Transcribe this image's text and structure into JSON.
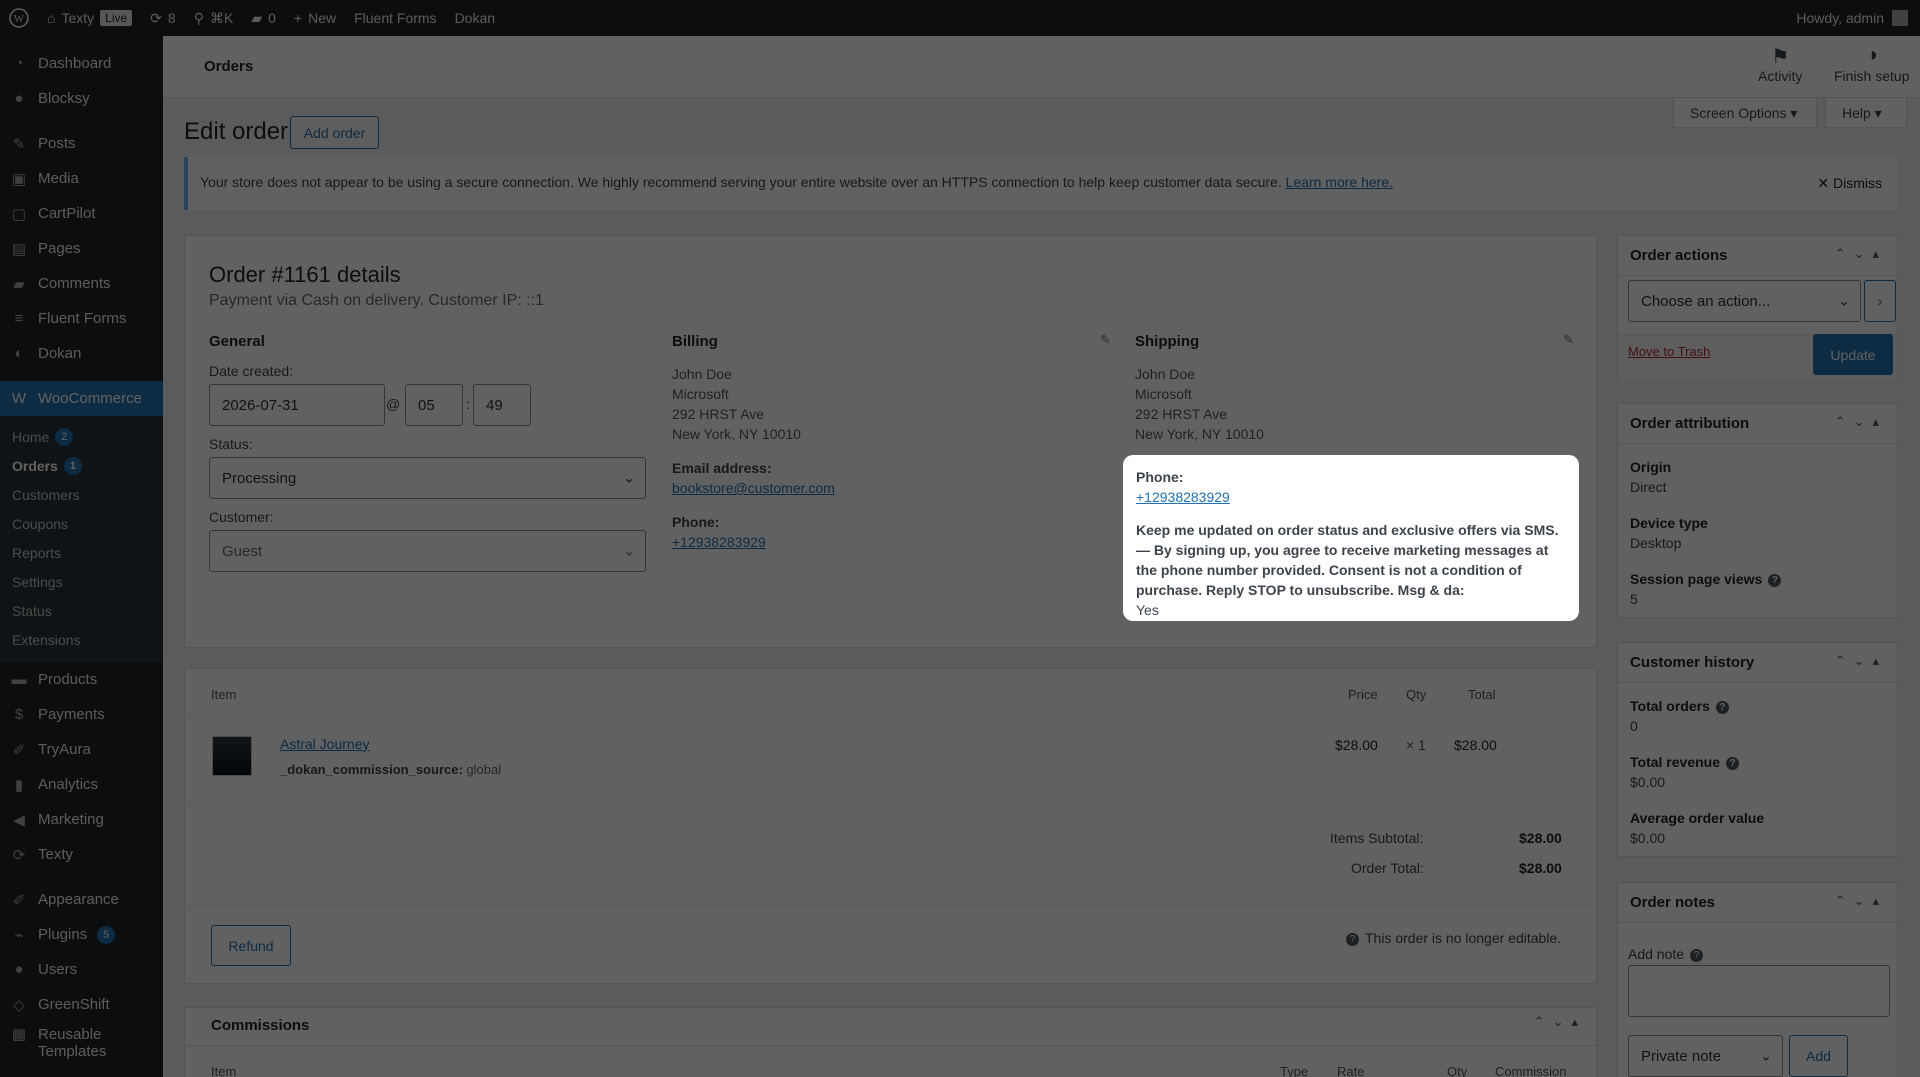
{
  "adminbar": {
    "site": "Texty",
    "live": "Live",
    "updates": "8",
    "search": "⌘K",
    "comments": "0",
    "new": "New",
    "fluent": "Fluent Forms",
    "dokan": "Dokan",
    "howdy": "Howdy, admin"
  },
  "sidebar": {
    "top": [
      {
        "label": "Dashboard",
        "icon": "gauge-icon"
      },
      {
        "label": "Blocksy",
        "icon": "blocksy-icon"
      }
    ],
    "main": [
      {
        "label": "Posts",
        "icon": "pin-icon"
      },
      {
        "label": "Media",
        "icon": "media-icon"
      },
      {
        "label": "CartPilot",
        "icon": "cartpilot-icon"
      },
      {
        "label": "Pages",
        "icon": "pages-icon"
      },
      {
        "label": "Comments",
        "icon": "comment-icon"
      },
      {
        "label": "Fluent Forms",
        "icon": "form-icon"
      },
      {
        "label": "Dokan",
        "icon": "dokan-icon"
      }
    ],
    "woo": "WooCommerce",
    "sub": [
      {
        "label": "Home",
        "badge": "2"
      },
      {
        "label": "Orders",
        "badge": "1"
      },
      {
        "label": "Customers"
      },
      {
        "label": "Coupons"
      },
      {
        "label": "Reports"
      },
      {
        "label": "Settings"
      },
      {
        "label": "Status"
      },
      {
        "label": "Extensions"
      }
    ],
    "more": [
      {
        "label": "Products",
        "icon": "box-icon"
      },
      {
        "label": "Payments",
        "icon": "dollar-icon"
      },
      {
        "label": "TryAura",
        "icon": "brush-icon"
      },
      {
        "label": "Analytics",
        "icon": "bar-chart-icon"
      },
      {
        "label": "Marketing",
        "icon": "megaphone-icon"
      },
      {
        "label": "Texty",
        "icon": "refresh-icon"
      }
    ],
    "tail": [
      {
        "label": "Appearance",
        "icon": "brush-icon"
      },
      {
        "label": "Plugins",
        "icon": "plug-icon",
        "badge": "5"
      },
      {
        "label": "Users",
        "icon": "user-icon"
      },
      {
        "label": "GreenShift",
        "icon": "shift-icon"
      },
      {
        "label": "Reusable Templates",
        "icon": "grid-icon"
      }
    ]
  },
  "header": {
    "title": "Orders",
    "activity": "Activity",
    "finish": "Finish setup",
    "screen_options": "Screen Options ▾",
    "help": "Help ▾"
  },
  "page": {
    "title": "Edit order",
    "add_order": "Add order"
  },
  "notice": {
    "text": "Your store does not appear to be using a secure connection. We highly recommend serving your entire website over an HTTPS connection to help keep customer data secure. ",
    "link": "Learn more here.",
    "dismiss": "Dismiss"
  },
  "order": {
    "title": "Order #1161 details",
    "subtitle": "Payment via Cash on delivery. Customer IP: ::1",
    "general": "General",
    "date_label": "Date created:",
    "date": "2026-07-31",
    "at": "@",
    "hour": "05",
    "colon": ":",
    "minute": "49",
    "status_label": "Status:",
    "status": "Processing",
    "customer_label": "Customer:",
    "customer": "Guest",
    "billing": {
      "title": "Billing",
      "lines": [
        "John Doe",
        "Microsoft",
        "292 HRST Ave",
        "New York, NY 10010"
      ],
      "email_label": "Email address:",
      "email": "bookstore@customer.com",
      "phone_label": "Phone:",
      "phone": "+12938283929"
    },
    "shipping": {
      "title": "Shipping",
      "lines": [
        "John Doe",
        "Microsoft",
        "292 HRST Ave",
        "New York, NY 10010"
      ]
    }
  },
  "popup": {
    "phone_label": "Phone:",
    "phone": "+12938283929",
    "consent": "Keep me updated on order status and exclusive offers via SMS. — By signing up, you agree to receive marketing messages at the phone number provided. Consent is not a condition of purchase. Reply STOP to unsubscribe. Msg & da:",
    "answer": "Yes"
  },
  "items": {
    "headers": [
      "Item",
      "Price",
      "Qty",
      "Total"
    ],
    "product": "Astral Journey",
    "meta_key": "_dokan_commission_source:",
    "meta_val": "global",
    "price": "$28.00",
    "qty": "× 1",
    "total": "$28.00",
    "subtotal_label": "Items Subtotal:",
    "subtotal": "$28.00",
    "ordertotal_label": "Order Total:",
    "ordertotal": "$28.00",
    "refund": "Refund",
    "not_editable": "This order is no longer editable."
  },
  "commissions": {
    "title": "Commissions",
    "headers": [
      "Item",
      "Type",
      "Rate",
      "Qty",
      "Commission"
    ]
  },
  "order_actions": {
    "title": "Order actions",
    "select": "Choose an action...",
    "trash": "Move to Trash",
    "update": "Update"
  },
  "attribution": {
    "title": "Order attribution",
    "origin_k": "Origin",
    "origin_v": "Direct",
    "device_k": "Device type",
    "device_v": "Desktop",
    "views_k": "Session page views",
    "views_v": "5"
  },
  "history": {
    "title": "Customer history",
    "orders_k": "Total orders",
    "orders_v": "0",
    "revenue_k": "Total revenue",
    "revenue_v": "$0.00",
    "avg_k": "Average order value",
    "avg_v": "$0.00"
  },
  "notes": {
    "title": "Order notes",
    "add_note": "Add note",
    "type": "Private note",
    "add": "Add"
  }
}
